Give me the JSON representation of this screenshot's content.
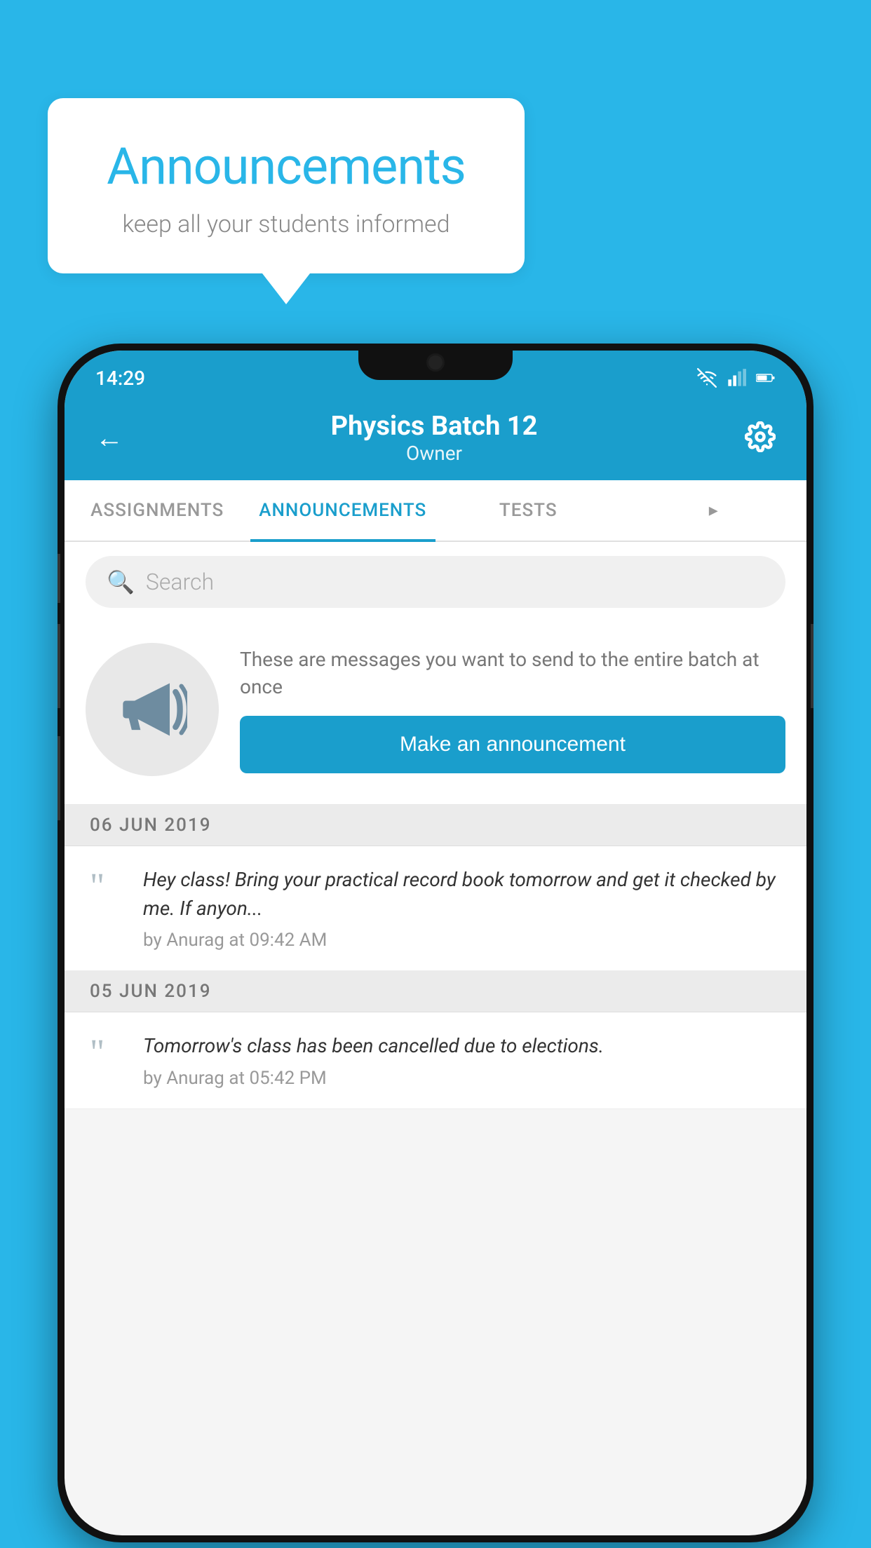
{
  "background_color": "#29b6e8",
  "speech_bubble": {
    "title": "Announcements",
    "subtitle": "keep all your students informed"
  },
  "status_bar": {
    "time": "14:29"
  },
  "app_header": {
    "title": "Physics Batch 12",
    "subtitle": "Owner",
    "back_label": "←"
  },
  "tabs": [
    {
      "label": "ASSIGNMENTS",
      "active": false
    },
    {
      "label": "ANNOUNCEMENTS",
      "active": true
    },
    {
      "label": "TESTS",
      "active": false
    },
    {
      "label": "",
      "active": false
    }
  ],
  "search": {
    "placeholder": "Search"
  },
  "cta": {
    "description": "These are messages you want to send to the entire batch at once",
    "button_label": "Make an announcement"
  },
  "announcements": [
    {
      "date": "06  JUN  2019",
      "text": "Hey class! Bring your practical record book tomorrow and get it checked by me. If anyon...",
      "meta": "by Anurag at 09:42 AM"
    },
    {
      "date": "05  JUN  2019",
      "text": "Tomorrow's class has been cancelled due to elections.",
      "meta": "by Anurag at 05:42 PM"
    }
  ]
}
